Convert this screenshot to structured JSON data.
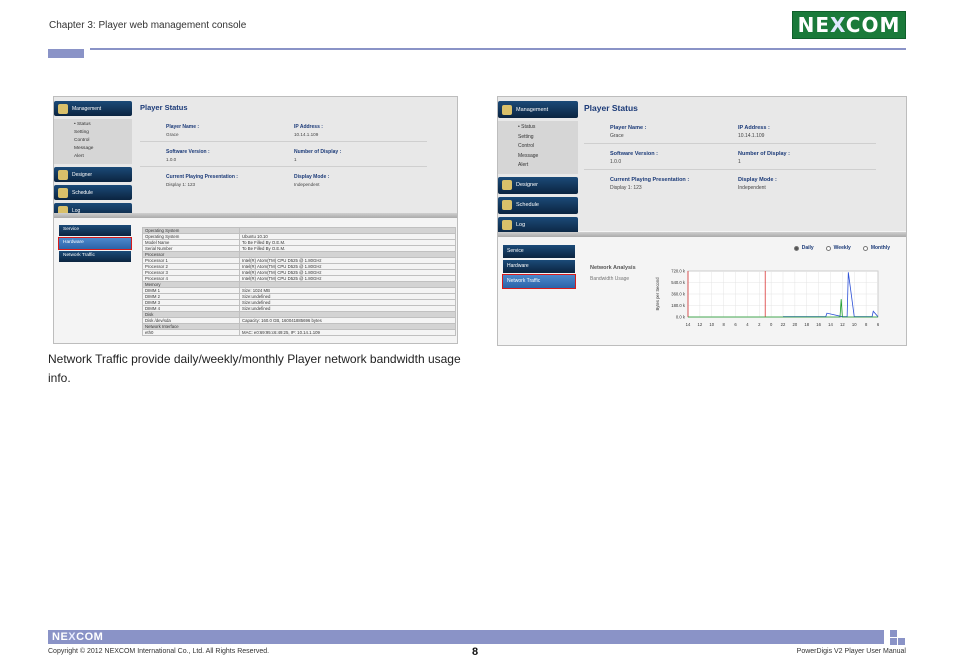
{
  "header": {
    "chapter": "Chapter 3: Player web management console",
    "logo": "NE COM"
  },
  "left_screenshot": {
    "nav": [
      {
        "label": "Management",
        "icon": "monitor-icon"
      },
      {
        "label": "Designer",
        "icon": "pencil-icon"
      },
      {
        "label": "Schedule",
        "icon": "calendar-icon"
      },
      {
        "label": "Log",
        "icon": "document-icon"
      }
    ],
    "submenu": [
      "• Status",
      "Setting",
      "Control",
      "Message",
      "Alert"
    ],
    "status_title": "Player Status",
    "fields": [
      {
        "label": "Player Name :",
        "value": "Grace",
        "label2": "IP Address :",
        "value2": "10.14.1.109"
      },
      {
        "label": "Software Version :",
        "value": "1.0.0",
        "label2": "Number of Display :",
        "value2": "1"
      },
      {
        "label": "Current Playing Presentation :",
        "value": "Display 1:  123",
        "label2": "Display Mode :",
        "value2": "Independent"
      }
    ],
    "lower_nav": [
      "Service",
      "Hardware",
      "Network Traffic"
    ],
    "hardware_rows": [
      {
        "section": true,
        "k": "Operating System",
        "v": ""
      },
      {
        "k": "Operating System",
        "v": "Ubuntu 10.10"
      },
      {
        "k": "Model Name",
        "v": "To Be Filled By O.E.M."
      },
      {
        "k": "Serial Number",
        "v": "To Be Filled By O.E.M."
      },
      {
        "section": true,
        "k": "Processor",
        "v": ""
      },
      {
        "k": "Processor 1",
        "v": "Intel(R) Atom(TM) CPU D525 @ 1.80GHz"
      },
      {
        "k": "Processor 2",
        "v": "Intel(R) Atom(TM) CPU D525 @ 1.80GHz"
      },
      {
        "k": "Processor 3",
        "v": "Intel(R) Atom(TM) CPU D525 @ 1.80GHz"
      },
      {
        "k": "Processor 4",
        "v": "Intel(R) Atom(TM) CPU D525 @ 1.80GHz"
      },
      {
        "section": true,
        "k": "Memory",
        "v": ""
      },
      {
        "k": "DIMM 1",
        "v": "Size: 1024 MB"
      },
      {
        "k": "DIMM 2",
        "v": "Size:undefined"
      },
      {
        "k": "DIMM 3",
        "v": "Size:undefined"
      },
      {
        "k": "DIMM 4",
        "v": "Size:undefined"
      },
      {
        "section": true,
        "k": "Disk",
        "v": ""
      },
      {
        "k": "Disk /dev/sda",
        "v": "Capacity: 160.0 GB, 160041885696 bytes"
      },
      {
        "section": true,
        "k": "Network Interface",
        "v": ""
      },
      {
        "k": "eth0",
        "v": "MAC: e0:69:95:c6:49:25, IP: 10.14.1.109"
      }
    ]
  },
  "right_screenshot": {
    "nav": [
      {
        "label": "Management",
        "icon": "monitor-icon"
      },
      {
        "label": "Designer",
        "icon": "pencil-icon"
      },
      {
        "label": "Schedule",
        "icon": "calendar-icon"
      },
      {
        "label": "Log",
        "icon": "document-icon"
      }
    ],
    "submenu": [
      "• Status",
      "Setting",
      "Control",
      "Message",
      "Alert"
    ],
    "status_title": "Player Status",
    "fields": [
      {
        "label": "Player Name :",
        "value": "Grace",
        "label2": "IP Address :",
        "value2": "10.14.1.109"
      },
      {
        "label": "Software Version :",
        "value": "1.0.0",
        "label2": "Number of Display :",
        "value2": "1"
      },
      {
        "label": "Current Playing Presentation :",
        "value": "Display 1:  123",
        "label2": "Display Mode :",
        "value2": "Independent"
      }
    ],
    "lower_nav": [
      "Service",
      "Hardware",
      "Network Traffic"
    ],
    "radios": [
      {
        "label": "Daily",
        "selected": true
      },
      {
        "label": "Weekly",
        "selected": false
      },
      {
        "label": "Monthly",
        "selected": false
      }
    ],
    "network_title": "Network Analysis",
    "network_subtitle": "Bandwidth Usage"
  },
  "chart_data": {
    "type": "line",
    "title": "",
    "xlabel": "",
    "ylabel": "Bytes per Second",
    "y_tick_labels": [
      "720.0 k",
      "540.0 k",
      "360.0 k",
      "180.0 k",
      "0.0 k"
    ],
    "y_ticks": [
      720,
      540,
      360,
      180,
      0
    ],
    "ylim": [
      0,
      720
    ],
    "x_tick_labels": [
      "14",
      "12",
      "10",
      "8",
      "6",
      "4",
      "2",
      "0",
      "22",
      "20",
      "18",
      "16",
      "14",
      "12",
      "10",
      "8",
      "6"
    ],
    "grid": true,
    "series": [
      {
        "color": "#2b4fd6",
        "x": [
          8,
          11.6,
          11.7,
          13,
          13.4,
          13.5,
          14,
          15.5,
          15.6,
          16
        ],
        "y": [
          5,
          5,
          60,
          5,
          5,
          700,
          5,
          5,
          90,
          5
        ]
      },
      {
        "color": "#1a9a2a",
        "x": [
          0,
          12.8,
          12.9,
          13.0,
          16
        ],
        "y": [
          0,
          0,
          280,
          0,
          0
        ]
      }
    ],
    "markers": [
      {
        "color": "#d61a1a",
        "x": 6.5
      },
      {
        "color": "#d61a1a",
        "x": 0.0
      }
    ]
  },
  "caption": "Network Traffic provide daily/weekly/monthly Player network bandwidth usage info.",
  "footer": {
    "logo": "NE COM",
    "copyright": "Copyright © 2012 NEXCOM International Co., Ltd. All Rights Reserved.",
    "page": "8",
    "manual": "PowerDigis V2 Player User Manual"
  }
}
